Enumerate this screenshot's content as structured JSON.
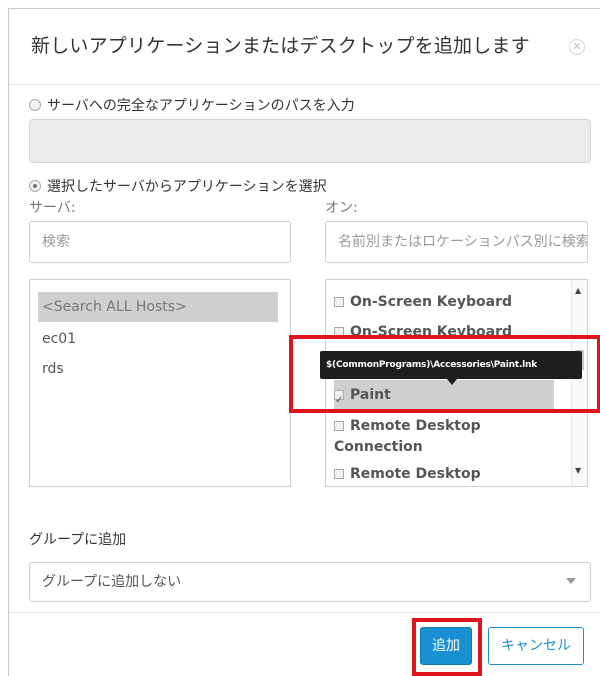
{
  "dialog": {
    "title": "新しいアプリケーションまたはデスクトップを追加します",
    "close_icon": "close-circle-icon"
  },
  "path_option": {
    "label": "サーバへの完全なアプリケーションのパスを入力",
    "value": ""
  },
  "select_option": {
    "label": "選択したサーバからアプリケーションを選択"
  },
  "server": {
    "label": "サーバ:",
    "search_placeholder": "検索",
    "hosts": [
      "<Search ALL Hosts>",
      "ec01",
      "rds"
    ]
  },
  "on": {
    "label": "オン:",
    "search_placeholder": "名前別またはロケーションパス別に検索",
    "apps": [
      {
        "label": "On-Screen Keyboard",
        "checked": false
      },
      {
        "label": "On-Screen Keyboard",
        "checked": false
      },
      {
        "label": "Paint",
        "checked": true
      },
      {
        "label": "Remote Desktop Connection",
        "checked": false
      },
      {
        "label": "Remote Desktop",
        "checked": false
      }
    ],
    "tooltip": "$(CommonPrograms)\\Accessories\\Paint.lnk"
  },
  "group": {
    "label": "グループに追加",
    "selected": "グループに追加しない"
  },
  "footer": {
    "add_label": "追加",
    "cancel_label": "キャンセル"
  },
  "colors": {
    "primary": "#1a8fd1",
    "highlight": "#e0141e"
  }
}
